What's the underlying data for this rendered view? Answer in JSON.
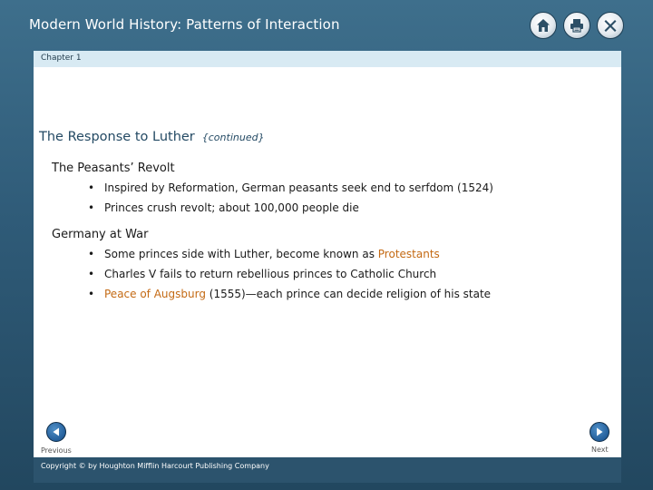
{
  "header": {
    "title": "Modern World History: Patterns of Interaction",
    "icons": [
      "home-icon",
      "print-icon",
      "close-icon"
    ]
  },
  "chapter": {
    "label": "Chapter 1"
  },
  "slide": {
    "heading": "The Response to Luther",
    "heading_sub": "{continued}",
    "sections": [
      {
        "title": "The Peasants’ Revolt",
        "bullets": [
          {
            "text": "Inspired by Reformation, German peasants seek end to serfdom (1524)"
          },
          {
            "text": "Princes crush revolt; about 100,000 people die"
          }
        ]
      },
      {
        "title": "Germany at War",
        "bullets": [
          {
            "pre": "Some princes side with Luther, become known as ",
            "highlight": "Protestants"
          },
          {
            "text": "Charles V fails to return rebellious princes to Catholic Church"
          },
          {
            "highlight": "Peace of Augsburg",
            "post": " (1555)—each prince can decide religion of his state"
          }
        ]
      }
    ]
  },
  "nav": {
    "previous": "Previous",
    "next": "Next"
  },
  "footer": {
    "copyright": "Copyright © by Houghton Mifflin Harcourt Publishing Company"
  },
  "colors": {
    "highlight": "#c46a14",
    "heading": "#244a64",
    "frame": "#2f5b78"
  }
}
